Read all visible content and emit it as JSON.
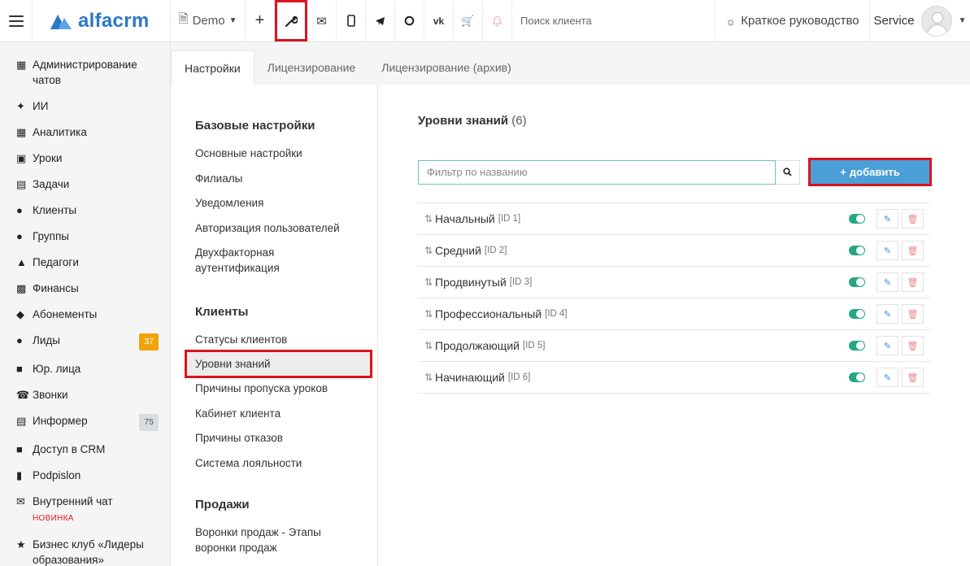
{
  "header": {
    "logo_text": "alfacrm",
    "branch": "Demo",
    "search_placeholder": "Поиск клиента",
    "guide_label": "Краткое руководство",
    "user_name": "Service"
  },
  "sidebar": {
    "items": [
      {
        "label": "Администрирование чатов",
        "icon": "chat-admin-icon"
      },
      {
        "label": "ИИ",
        "icon": "sparkle-icon"
      },
      {
        "label": "Аналитика",
        "icon": "map-icon"
      },
      {
        "label": "Уроки",
        "icon": "calendar-icon"
      },
      {
        "label": "Задачи",
        "icon": "clipboard-icon"
      },
      {
        "label": "Клиенты",
        "icon": "user-icon"
      },
      {
        "label": "Группы",
        "icon": "group-icon"
      },
      {
        "label": "Педагоги",
        "icon": "graduation-icon"
      },
      {
        "label": "Финансы",
        "icon": "money-icon"
      },
      {
        "label": "Абонементы",
        "icon": "tag-icon"
      },
      {
        "label": "Лиды",
        "icon": "user-plus-icon",
        "badge": "37"
      },
      {
        "label": "Юр. лица",
        "icon": "briefcase-icon"
      },
      {
        "label": "Звонки",
        "icon": "phone-icon"
      },
      {
        "label": "Информер",
        "icon": "file-icon",
        "badge": "75"
      },
      {
        "label": "Доступ в CRM",
        "icon": "lock-icon"
      },
      {
        "label": "Podpislon",
        "icon": "document-icon"
      },
      {
        "label": "Внутренний чат",
        "icon": "envelope-icon",
        "tag": "НОВИНКА"
      },
      {
        "label": "Бизнес клуб «Лидеры образования»",
        "icon": "star-icon"
      }
    ]
  },
  "tabs": [
    "Настройки",
    "Лицензирование",
    "Лицензирование (архив)"
  ],
  "settings_nav": {
    "basic_head": "Базовые настройки",
    "basic": [
      "Основные настройки",
      "Филиалы",
      "Уведомления",
      "Авторизация пользователей",
      "Двухфакторная аутентификация"
    ],
    "clients_head": "Клиенты",
    "clients": [
      "Статусы клиентов",
      "Уровни знаний",
      "Причины пропуска уроков",
      "Кабинет клиента",
      "Причины отказов",
      "Система лояльности"
    ],
    "sales_head": "Продажи",
    "sales": [
      "Воронки продаж - Этапы воронки продаж"
    ]
  },
  "content": {
    "title": "Уровни знаний",
    "count": "(6)",
    "filter_placeholder": "Фильтр по названию",
    "add_label": "добавить",
    "levels": [
      {
        "name": "Начальный",
        "id": "[ID 1]"
      },
      {
        "name": "Средний",
        "id": "[ID 2]"
      },
      {
        "name": "Продвинутый",
        "id": "[ID 3]"
      },
      {
        "name": "Профессиональный",
        "id": "[ID 4]"
      },
      {
        "name": "Продолжающий",
        "id": "[ID 5]"
      },
      {
        "name": "Начинающий",
        "id": "[ID 6]"
      }
    ]
  },
  "colors": {
    "accent": "#4a9fd8",
    "highlight": "#d9141e",
    "toggle_on": "#25a87f",
    "badge_orange": "#f0a30a"
  }
}
